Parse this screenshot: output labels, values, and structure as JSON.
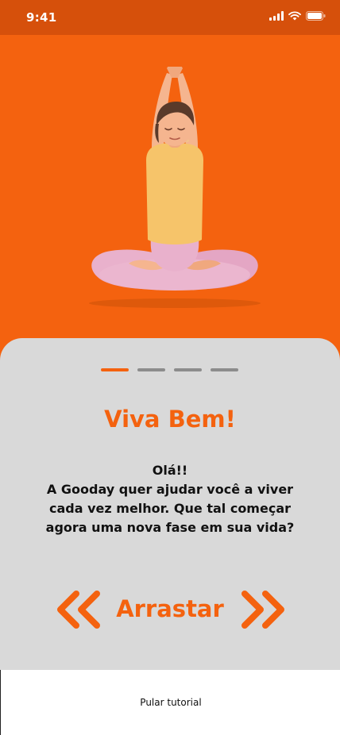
{
  "status_bar": {
    "time": "9:41",
    "icons": [
      "signal-icon",
      "wifi-icon",
      "battery-icon"
    ]
  },
  "colors": {
    "accent": "#F4620F",
    "status_bar": "#D6500B",
    "sheet": "#D9D9D9"
  },
  "hero": {
    "illustration": "yoga-woman-meditation"
  },
  "onboarding": {
    "pager": {
      "total": 4,
      "current": 1
    },
    "title": "Viva Bem!",
    "greeting": "Olá!!",
    "description": "A Gooday quer ajudar você a viver cada vez melhor. Que tal começar agora uma nova fase em sua vida?",
    "swipe_label": "Arrastar",
    "swipe_icons": [
      "double-chevron-left-icon",
      "double-chevron-right-icon"
    ]
  },
  "footer": {
    "skip_label": "Pular tutorial"
  }
}
